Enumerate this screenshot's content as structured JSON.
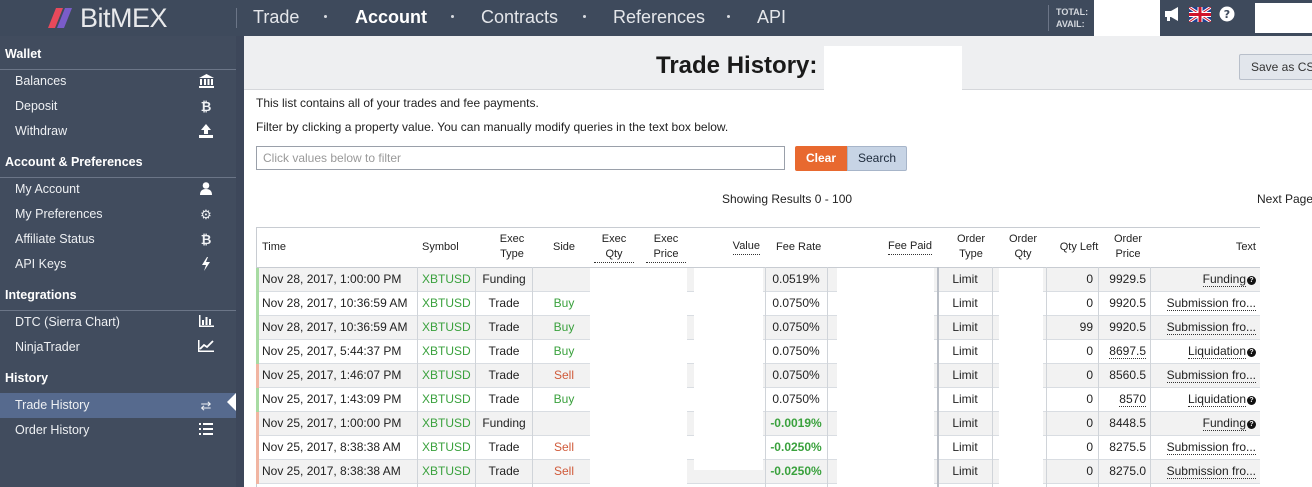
{
  "brand": {
    "name": "BitMEX",
    "logo_icon": "bitmex-logo-icon"
  },
  "topnav": {
    "items": [
      {
        "label": "Trade",
        "active": false
      },
      {
        "label": "Account",
        "active": true
      },
      {
        "label": "Contracts",
        "active": false
      },
      {
        "label": "References",
        "active": false
      },
      {
        "label": "API",
        "active": false
      }
    ],
    "totals": {
      "total_label": "TOTAL:",
      "avail_label": "AVAIL:"
    },
    "icons": [
      "megaphone-icon",
      "uk-flag-icon",
      "help-icon"
    ]
  },
  "sidebar": {
    "sections": [
      {
        "title": "Wallet",
        "items": [
          {
            "label": "Balances",
            "icon": "bank-icon"
          },
          {
            "label": "Deposit",
            "icon": "bitcoin-icon"
          },
          {
            "label": "Withdraw",
            "icon": "upload-icon"
          }
        ]
      },
      {
        "title": "Account & Preferences",
        "items": [
          {
            "label": "My Account",
            "icon": "user-icon"
          },
          {
            "label": "My Preferences",
            "icon": "gear-icon"
          },
          {
            "label": "Affiliate Status",
            "icon": "bitcoin-icon"
          },
          {
            "label": "API Keys",
            "icon": "bolt-icon"
          }
        ]
      },
      {
        "title": "Integrations",
        "items": [
          {
            "label": "DTC (Sierra Chart)",
            "icon": "bar-chart-icon"
          },
          {
            "label": "NinjaTrader",
            "icon": "line-chart-icon"
          }
        ]
      },
      {
        "title": "History",
        "items": [
          {
            "label": "Trade History",
            "icon": "exchange-arrows-icon",
            "active": true
          },
          {
            "label": "Order History",
            "icon": "list-icon"
          }
        ]
      }
    ]
  },
  "main": {
    "title": "Trade History:",
    "save_csv": "Save as CSV",
    "intro1": "This list contains all of your trades and fee payments.",
    "intro2": "Filter by clicking a property value. You can manually modify queries in the text box below.",
    "filter_placeholder": "Click values below to filter",
    "clear_label": "Clear",
    "search_label": "Search",
    "results_text": "Showing Results 0 - 100",
    "next_page": "Next Page"
  },
  "table": {
    "headers": {
      "time": "Time",
      "symbol": "Symbol",
      "exec_type": "Exec Type",
      "side": "Side",
      "exec_qty": "Exec Qty",
      "exec_price": "Exec Price",
      "value": "Value",
      "fee_rate": "Fee Rate",
      "fee_paid": "Fee Paid",
      "order_type": "Order Type",
      "order_qty": "Order Qty",
      "qty_left": "Qty Left",
      "order_price": "Order Price",
      "text": "Text"
    },
    "rows": [
      {
        "time": "Nov 28, 2017, 1:00:00 PM",
        "symbol": "XBTUSD",
        "exec_type": "Funding",
        "side": "",
        "side_color": "",
        "fee_rate": "0.0519%",
        "fee_negative": false,
        "order_type": "Limit",
        "qty_left": "0",
        "order_price": "9929.5",
        "text": "Funding",
        "text_help": true,
        "edge": "green"
      },
      {
        "time": "Nov 28, 2017, 10:36:59 AM",
        "symbol": "XBTUSD",
        "exec_type": "Trade",
        "side": "Buy",
        "side_color": "green",
        "fee_rate": "0.0750%",
        "fee_negative": false,
        "order_type": "Limit",
        "qty_left": "0",
        "order_price": "9920.5",
        "text": "Submission fro...",
        "text_help": false,
        "edge": "green"
      },
      {
        "time": "Nov 28, 2017, 10:36:59 AM",
        "symbol": "XBTUSD",
        "exec_type": "Trade",
        "side": "Buy",
        "side_color": "green",
        "fee_rate": "0.0750%",
        "fee_negative": false,
        "order_type": "Limit",
        "qty_left": "99",
        "order_price": "9920.5",
        "text": "Submission fro...",
        "text_help": false,
        "edge": "green"
      },
      {
        "time": "Nov 25, 2017, 5:44:37 PM",
        "symbol": "XBTUSD",
        "exec_type": "Trade",
        "side": "Buy",
        "side_color": "green",
        "fee_rate": "0.0750%",
        "fee_negative": false,
        "order_type": "Limit",
        "qty_left": "0",
        "order_price": "8697.5",
        "order_price_underline": true,
        "text": "Liquidation",
        "text_help": true,
        "edge": "green"
      },
      {
        "time": "Nov 25, 2017, 1:46:07 PM",
        "symbol": "XBTUSD",
        "exec_type": "Trade",
        "side": "Sell",
        "side_color": "red",
        "fee_rate": "0.0750%",
        "fee_negative": false,
        "order_type": "Limit",
        "qty_left": "0",
        "order_price": "8560.5",
        "text": "Submission fro...",
        "text_help": false,
        "edge": "red"
      },
      {
        "time": "Nov 25, 2017, 1:43:09 PM",
        "symbol": "XBTUSD",
        "exec_type": "Trade",
        "side": "Buy",
        "side_color": "green",
        "fee_rate": "0.0750%",
        "fee_negative": false,
        "order_type": "Limit",
        "qty_left": "0",
        "order_price": "8570",
        "order_price_underline": true,
        "text": "Liquidation",
        "text_help": true,
        "edge": "green"
      },
      {
        "time": "Nov 25, 2017, 1:00:00 PM",
        "symbol": "XBTUSD",
        "exec_type": "Funding",
        "side": "",
        "side_color": "",
        "fee_rate": "-0.0019%",
        "fee_negative": true,
        "order_type": "Limit",
        "qty_left": "0",
        "order_price": "8448.5",
        "text": "Funding",
        "text_help": true,
        "edge": "red"
      },
      {
        "time": "Nov 25, 2017, 8:38:38 AM",
        "symbol": "XBTUSD",
        "exec_type": "Trade",
        "side": "Sell",
        "side_color": "red",
        "fee_rate": "-0.0250%",
        "fee_negative": true,
        "order_type": "Limit",
        "qty_left": "0",
        "order_price": "8275.5",
        "text": "Submission fro...",
        "text_help": false,
        "edge": "red"
      },
      {
        "time": "Nov 25, 2017, 8:38:38 AM",
        "symbol": "XBTUSD",
        "exec_type": "Trade",
        "side": "Sell",
        "side_color": "red",
        "fee_rate": "-0.0250%",
        "fee_negative": true,
        "order_type": "Limit",
        "qty_left": "0",
        "order_price": "8275.0",
        "text": "Submission fro...",
        "text_help": false,
        "edge": "red"
      }
    ]
  },
  "colors": {
    "nav_bg": "#3e4a5c",
    "sidebar_bg": "#414c5e",
    "active_item": "#566a8e",
    "clear_btn": "#e8692f",
    "buy_green": "#3aa13d",
    "sell_red": "#d05a3a"
  }
}
